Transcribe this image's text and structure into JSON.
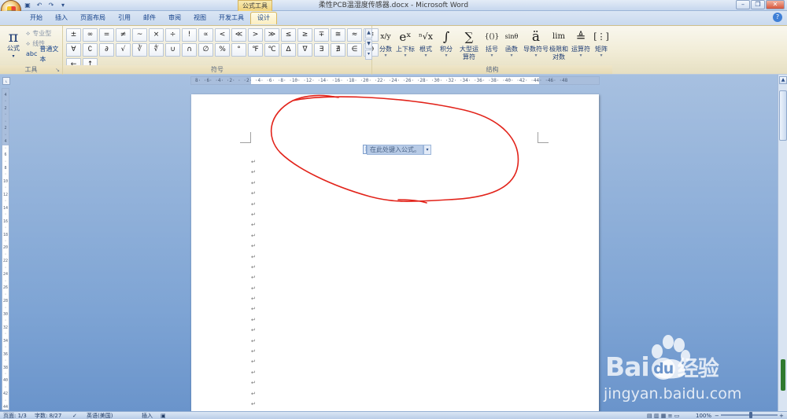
{
  "app": {
    "window_title": "柔性PCB温湿度传感器.docx - Microsoft Word",
    "contextual_tab_group": "公式工具"
  },
  "tabs": [
    {
      "label": "开始"
    },
    {
      "label": "插入"
    },
    {
      "label": "页面布局"
    },
    {
      "label": "引用"
    },
    {
      "label": "邮件"
    },
    {
      "label": "审阅"
    },
    {
      "label": "视图"
    },
    {
      "label": "开发工具"
    },
    {
      "label": "设计",
      "active": true
    }
  ],
  "ribbon": {
    "tools_group": {
      "label": "工具",
      "equation_button": "公式",
      "options": [
        "专业型",
        "线性",
        "普通文本"
      ]
    },
    "symbols_group": {
      "label": "符号",
      "symbols": [
        "±",
        "∞",
        "=",
        "≠",
        "~",
        "×",
        "÷",
        "!",
        "∝",
        "<",
        "≪",
        ">",
        "≫",
        "≤",
        "≥",
        "∓",
        "≅",
        "≈",
        "≡",
        "∀",
        "∁",
        "∂",
        "√",
        "∛",
        "∜",
        "∪",
        "∩",
        "∅",
        "%",
        "°",
        "℉",
        "℃",
        "∆",
        "∇",
        "∃",
        "∄",
        "∈",
        "∋",
        "←",
        "↑"
      ]
    },
    "structures_group": {
      "label": "结构",
      "items": [
        {
          "label": "分数",
          "icon": "x/y"
        },
        {
          "label": "上下标",
          "icon": "eˣ"
        },
        {
          "label": "根式",
          "icon": "ⁿ√x"
        },
        {
          "label": "积分",
          "icon": "∫"
        },
        {
          "label": "大型运算符",
          "icon": "∑"
        },
        {
          "label": "括号",
          "icon": "{()}"
        },
        {
          "label": "函数",
          "icon": "sinθ"
        },
        {
          "label": "导数符号",
          "icon": "ä"
        },
        {
          "label": "极限和对数",
          "icon": "lim"
        },
        {
          "label": "运算符",
          "icon": "≜"
        },
        {
          "label": "矩阵",
          "icon": "[⋮]"
        }
      ]
    }
  },
  "ruler": {
    "horizontal_ticks": "8· ·6· ·4· ·2· · ·2· ·4· ·6· ·8· ·10· ·12· ·14· ·16· ·18· ·20· ·22· ·24· ·26· ·28· ·30· ·32· ·34· ·36· ·38· ·40· ·42· ·44· ·46· ·48",
    "vertical_ticks": "4\n·\n2\n·\n·\n2\n·\n4\n·\n6\n·\n8\n·\n10\n·\n12\n·\n14\n·\n16\n·\n18\n·\n20\n·\n22\n·\n24\n·\n26\n·\n28\n·\n30\n·\n32\n·\n34\n·\n36\n·\n38\n·\n40\n·\n42\n·\n44\n·\n46\n·\n48"
  },
  "document": {
    "equation_placeholder": "在此处键入公式。",
    "paragraph_mark": "↵",
    "paragraph_count": 24
  },
  "statusbar": {
    "page": "页面: 1/3",
    "words": "字数: 8/27",
    "language": "英语(美国)",
    "mode": "插入",
    "zoom": "100%"
  },
  "watermark": {
    "brand": "Bai",
    "brand_suffix": "经验",
    "url": "jingyan.baidu.com"
  },
  "colors": {
    "annotation": "#e2231a",
    "ribbon_bg": "#f1ecd6",
    "accent": "#15428b"
  }
}
